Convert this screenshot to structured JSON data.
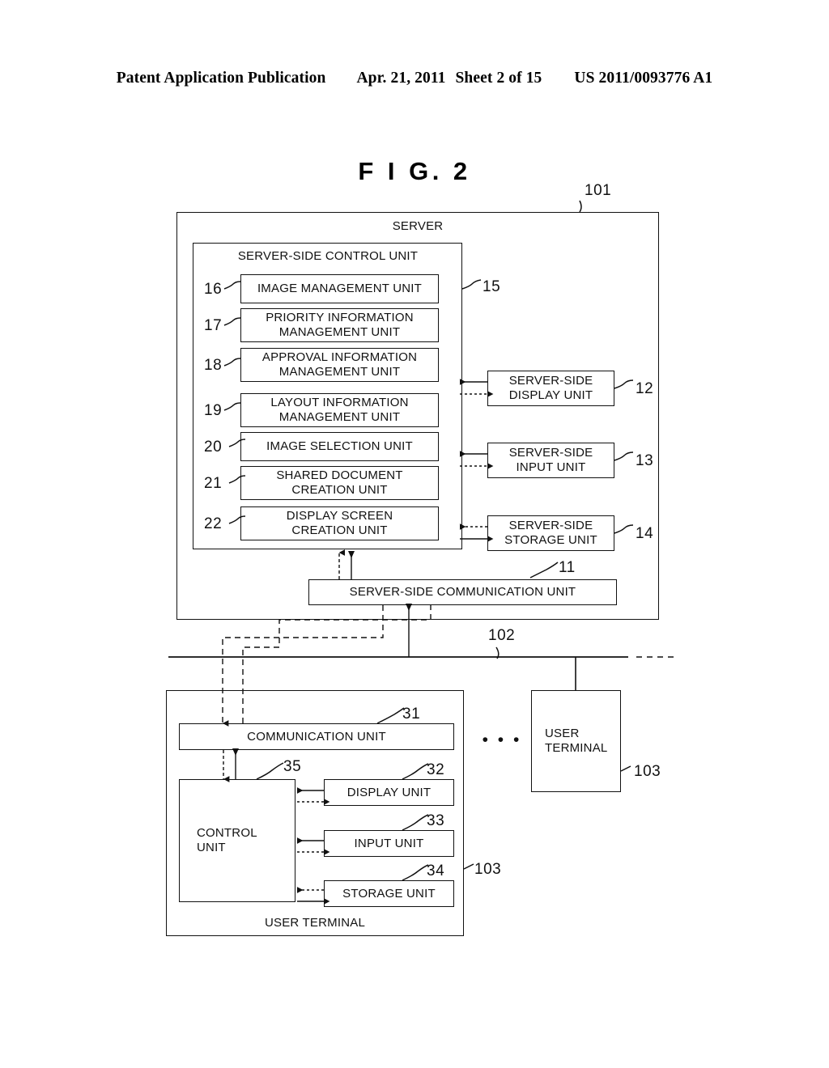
{
  "header": {
    "publication": "Patent Application Publication",
    "date": "Apr. 21, 2011",
    "sheet": "Sheet 2 of 15",
    "docnum": "US 2011/0093776 A1"
  },
  "figure": {
    "title": "F I G.  2"
  },
  "server": {
    "title": "SERVER",
    "ref": "101",
    "control_unit": {
      "title": "SERVER-SIDE CONTROL UNIT",
      "ref": "15",
      "modules": [
        {
          "ref": "16",
          "label": "IMAGE MANAGEMENT UNIT"
        },
        {
          "ref": "17",
          "label": "PRIORITY INFORMATION\nMANAGEMENT UNIT"
        },
        {
          "ref": "18",
          "label": "APPROVAL INFORMATION\nMANAGEMENT UNIT"
        },
        {
          "ref": "19",
          "label": "LAYOUT INFORMATION\nMANAGEMENT UNIT"
        },
        {
          "ref": "20",
          "label": "IMAGE SELECTION UNIT"
        },
        {
          "ref": "21",
          "label": "SHARED DOCUMENT\nCREATION UNIT"
        },
        {
          "ref": "22",
          "label": "DISPLAY SCREEN\nCREATION UNIT"
        }
      ]
    },
    "peripherals": [
      {
        "ref": "12",
        "label": "SERVER-SIDE\nDISPLAY UNIT"
      },
      {
        "ref": "13",
        "label": "SERVER-SIDE\nINPUT UNIT"
      },
      {
        "ref": "14",
        "label": "SERVER-SIDE\nSTORAGE UNIT"
      }
    ],
    "communication": {
      "ref": "11",
      "label": "SERVER-SIDE COMMUNICATION UNIT"
    }
  },
  "network": {
    "ref": "102"
  },
  "terminal": {
    "title": "USER TERMINAL",
    "ref": "103",
    "communication": {
      "ref": "31",
      "label": "COMMUNICATION UNIT"
    },
    "control": {
      "ref": "35",
      "label": "CONTROL\nUNIT"
    },
    "peripherals": [
      {
        "ref": "32",
        "label": "DISPLAY UNIT"
      },
      {
        "ref": "33",
        "label": "INPUT UNIT"
      },
      {
        "ref": "34",
        "label": "STORAGE UNIT"
      }
    ]
  },
  "other_terminal": {
    "label": "USER\nTERMINAL",
    "ref": "103",
    "ellipsis": "• • •"
  },
  "colors": {
    "ink": "#111111",
    "paper": "#ffffff"
  }
}
